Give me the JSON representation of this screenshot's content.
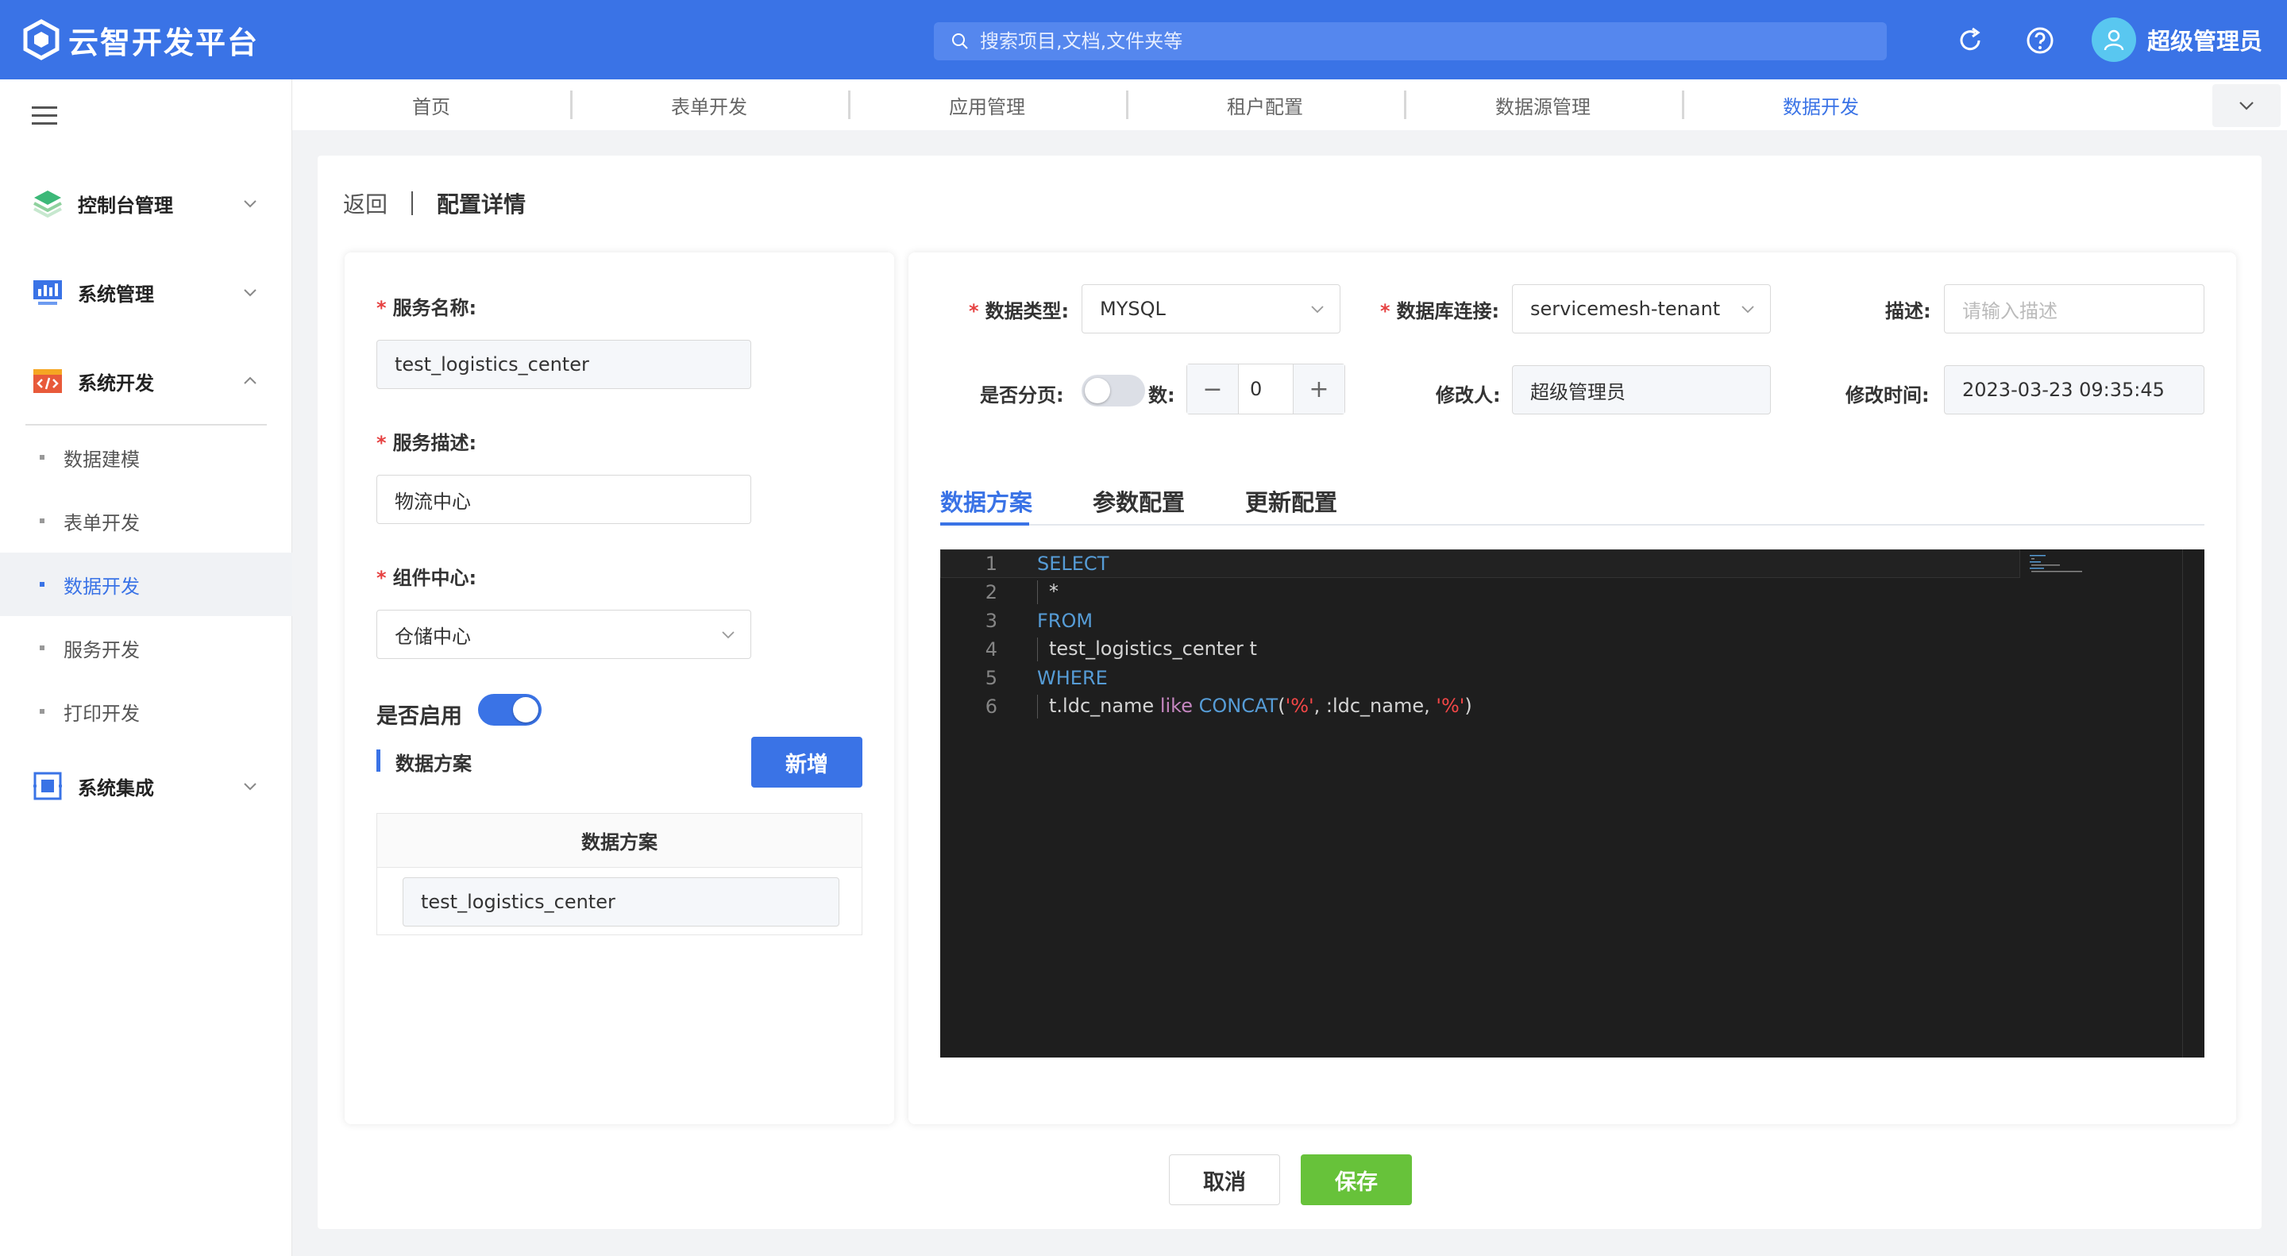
{
  "app": {
    "title": "云智开发平台"
  },
  "header": {
    "search_placeholder": "搜索项目,文档,文件夹等",
    "user_name": "超级管理员"
  },
  "sidebar": {
    "groups": [
      {
        "label": "控制台管理"
      },
      {
        "label": "系统管理"
      },
      {
        "label": "系统开发"
      },
      {
        "label": "系统集成"
      }
    ],
    "sub_items": [
      {
        "label": "数据建模"
      },
      {
        "label": "表单开发"
      },
      {
        "label": "数据开发"
      },
      {
        "label": "服务开发"
      },
      {
        "label": "打印开发"
      }
    ]
  },
  "tabs": [
    {
      "label": "首页"
    },
    {
      "label": "表单开发"
    },
    {
      "label": "应用管理"
    },
    {
      "label": "租户配置"
    },
    {
      "label": "数据源管理"
    },
    {
      "label": "数据开发"
    }
  ],
  "breadcrumb": {
    "back": "返回",
    "title": "配置详情"
  },
  "left_form": {
    "service_name_label": "服务名称:",
    "service_name_value": "test_logistics_center",
    "service_desc_label": "服务描述:",
    "service_desc_value": "物流中心",
    "component_label": "组件中心:",
    "component_value": "仓储中心",
    "enable_label": "是否启用",
    "enabled": true,
    "solution_title": "数据方案",
    "add_button": "新增",
    "table_header": "数据方案",
    "table_rows": [
      "test_logistics_center"
    ]
  },
  "right_form": {
    "data_type_label": "数据类型:",
    "data_type_value": "MYSQL",
    "db_conn_label": "数据库连接:",
    "db_conn_value": "servicemesh-tenant",
    "desc_label": "描述:",
    "desc_placeholder": "请输入描述",
    "paging_label": "是否分页:",
    "paging_enabled": false,
    "count_label": "数:",
    "count_value": "0",
    "modifier_label": "修改人:",
    "modifier_value": "超级管理员",
    "modify_time_label": "修改时间:",
    "modify_time_value": "2023-03-23 09:35:45"
  },
  "sub_tabs": [
    {
      "label": "数据方案"
    },
    {
      "label": "参数配置"
    },
    {
      "label": "更新配置"
    }
  ],
  "editor": {
    "lines": [
      {
        "n": "1",
        "kw": "SELECT"
      },
      {
        "n": "2",
        "text": "*"
      },
      {
        "n": "3",
        "kw": "FROM"
      },
      {
        "n": "4",
        "text": "test_logistics_center t"
      },
      {
        "n": "5",
        "kw": "WHERE"
      },
      {
        "n": "6",
        "col": "t.ldc_name",
        "op": "like",
        "fn": "CONCAT",
        "p1": "(",
        "s1": "'%'",
        "mid": ", :ldc_name, ",
        "s2": "'%'",
        "p2": ")"
      }
    ]
  },
  "footer": {
    "cancel": "取消",
    "save": "保存"
  },
  "colors": {
    "primary": "#3a73e6",
    "success": "#67c23a",
    "danger": "#e64242"
  }
}
